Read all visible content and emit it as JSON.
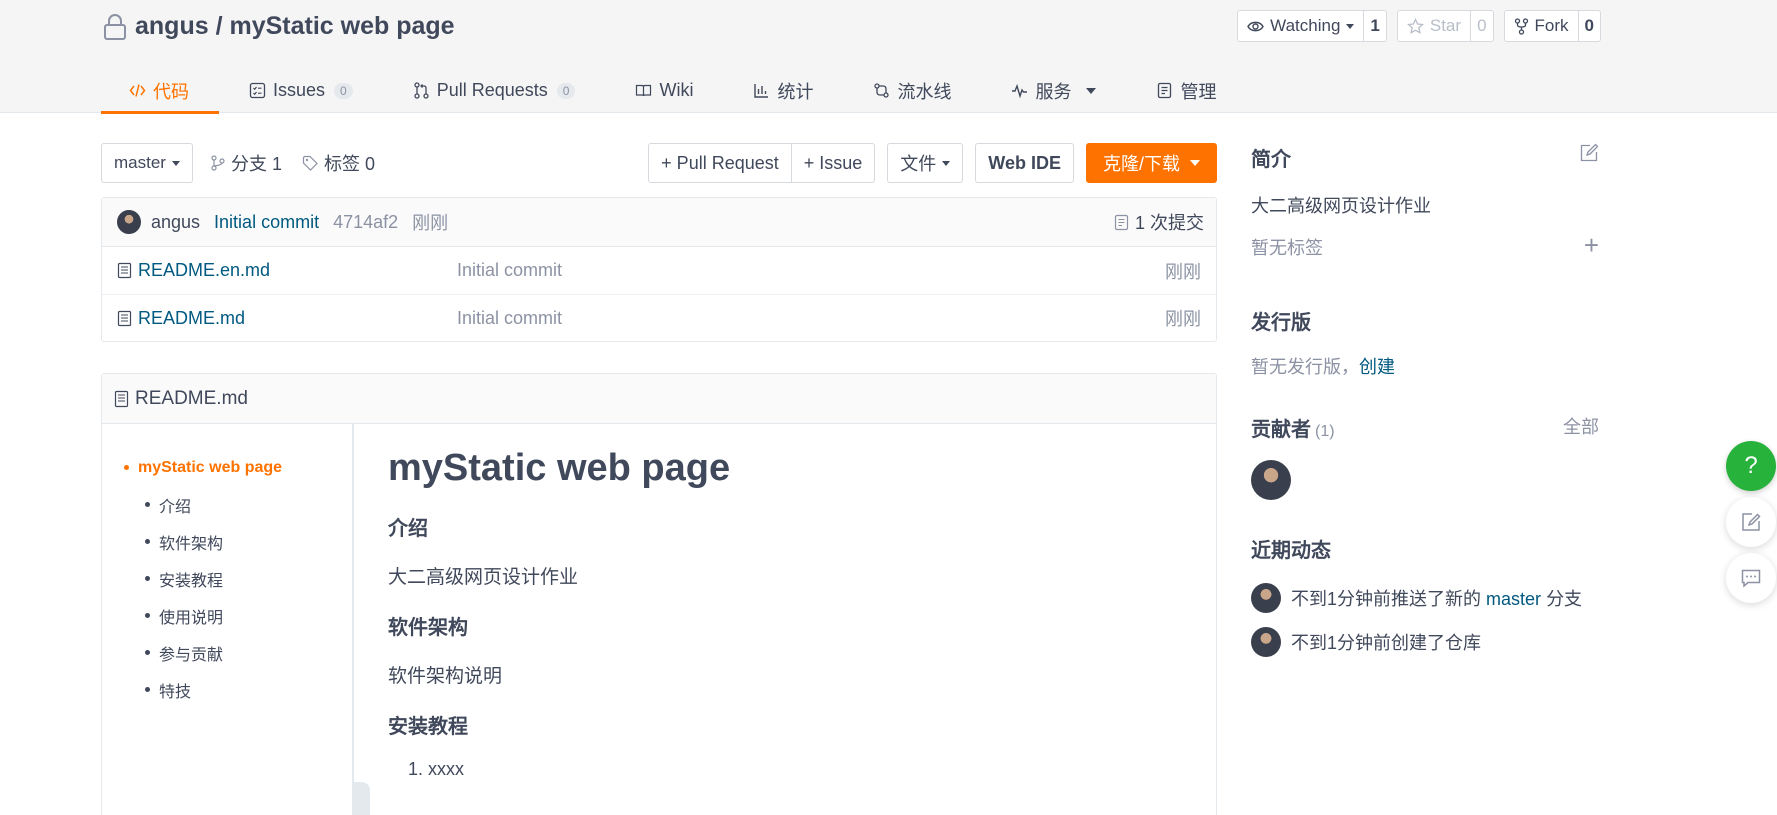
{
  "repo": {
    "owner": "angus",
    "separator": "/",
    "name": "myStatic web page"
  },
  "actions": {
    "watch": {
      "label": "Watching",
      "count": "1"
    },
    "star": {
      "label": "Star",
      "count": "0"
    },
    "fork": {
      "label": "Fork",
      "count": "0"
    }
  },
  "tabs": [
    {
      "label": "代码",
      "icon": "code-icon"
    },
    {
      "label": "Issues",
      "badge": "0",
      "icon": "issues-icon"
    },
    {
      "label": "Pull Requests",
      "badge": "0",
      "icon": "pull-request-icon"
    },
    {
      "label": "Wiki",
      "icon": "wiki-icon"
    },
    {
      "label": "统计",
      "icon": "stats-icon"
    },
    {
      "label": "流水线",
      "icon": "pipeline-icon"
    },
    {
      "label": "服务",
      "icon": "service-icon"
    },
    {
      "label": "管理",
      "icon": "manage-icon"
    }
  ],
  "branchbar": {
    "branch": "master",
    "branches": "分支 1",
    "tags": "标签 0",
    "pull_request": "+ Pull Request",
    "issue": "+ Issue",
    "files": "文件",
    "web_ide": "Web IDE",
    "clone": "克隆/下载"
  },
  "commit": {
    "author": "angus",
    "message": "Initial commit",
    "sha": "4714af2",
    "time": "刚刚",
    "count": "1 次提交"
  },
  "files": [
    {
      "name": "README.en.md",
      "message": "Initial commit",
      "time": "刚刚"
    },
    {
      "name": "README.md",
      "message": "Initial commit",
      "time": "刚刚"
    }
  ],
  "readme": {
    "filename": "README.md",
    "toc": [
      "myStatic web page",
      "介绍",
      "软件架构",
      "安装教程",
      "使用说明",
      "参与贡献",
      "特技"
    ],
    "title": "myStatic web page",
    "intro_heading": "介绍",
    "intro_text": "大二高级网页设计作业",
    "arch_heading": "软件架构",
    "arch_text": "软件架构说明",
    "install_heading": "安装教程",
    "install_item": "1. xxxx"
  },
  "sidebar": {
    "about_heading": "简介",
    "about_text": "大二高级网页设计作业",
    "no_tags": "暂无标签",
    "release_heading": "发行版",
    "no_release": "暂无发行版，",
    "create": "创建",
    "contributors_heading": "贡献者",
    "contributors_count": "(1)",
    "all": "全部",
    "activity_heading": "近期动态",
    "activity1_prefix": "不到1分钟前推送了新的",
    "activity1_branch": "master",
    "activity1_suffix": "分支",
    "activity2": "不到1分钟前创建了仓库"
  },
  "floating": {
    "help": "?"
  },
  "colors": {
    "accent": "#fe7300",
    "link": "#005980",
    "help": "#27b23b"
  }
}
